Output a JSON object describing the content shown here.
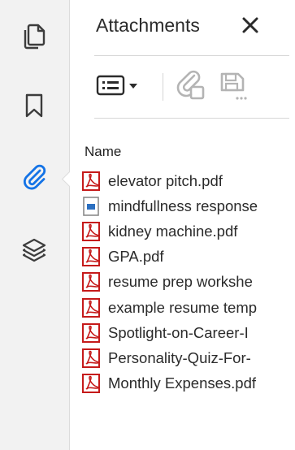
{
  "rail": {
    "items": [
      {
        "name": "pages-icon"
      },
      {
        "name": "bookmark-icon"
      },
      {
        "name": "attachment-icon",
        "active": true
      },
      {
        "name": "layers-icon"
      }
    ],
    "accent_color": "#1473e6"
  },
  "panel": {
    "title": "Attachments",
    "close_icon": "close-icon",
    "toolbar": {
      "options_icon": "list-options-icon",
      "add_icon": "add-attachment-icon",
      "save_icon": "save-attachment-icon"
    },
    "column_header": "Name",
    "files": [
      {
        "name": "elevator pitch.pdf",
        "type": "pdf"
      },
      {
        "name": "mindfullness response",
        "type": "doc"
      },
      {
        "name": "kidney machine.pdf",
        "type": "pdf"
      },
      {
        "name": "GPA.pdf",
        "type": "pdf"
      },
      {
        "name": "resume prep workshe",
        "type": "pdf"
      },
      {
        "name": "example resume temp",
        "type": "pdf"
      },
      {
        "name": "Spotlight-on-Career-I",
        "type": "pdf"
      },
      {
        "name": "Personality-Quiz-For-",
        "type": "pdf"
      },
      {
        "name": "Monthly Expenses.pdf",
        "type": "pdf"
      }
    ]
  }
}
